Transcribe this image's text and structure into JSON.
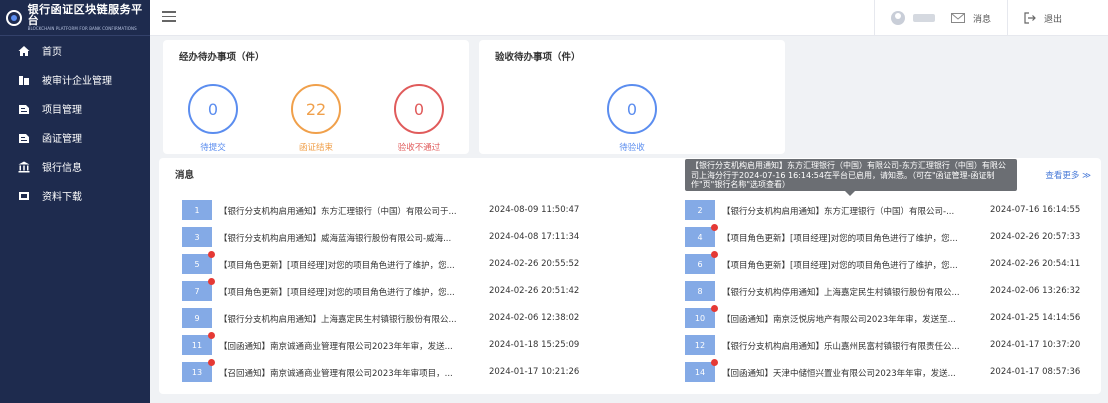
{
  "logo": {
    "title": "银行函证区块链服务平台",
    "subtitle": "BLOCKCHAIN PLATFORM FOR BANK CONFIRMATIONS"
  },
  "sidebar": {
    "items": [
      {
        "label": "首页",
        "icon": "home-icon"
      },
      {
        "label": "被审计企业管理",
        "icon": "building-icon"
      },
      {
        "label": "项目管理",
        "icon": "project-icon"
      },
      {
        "label": "函证管理",
        "icon": "letter-icon"
      },
      {
        "label": "银行信息",
        "icon": "bank-icon"
      },
      {
        "label": "资料下载",
        "icon": "download-icon"
      }
    ]
  },
  "header": {
    "messages_label": "消息",
    "logout_label": "退出"
  },
  "pending": {
    "title": "经办待办事项（件）",
    "stats": [
      {
        "value": "0",
        "label": "待提交",
        "color": "#5b8def"
      },
      {
        "value": "22",
        "label": "函证结束",
        "color": "#f0a04b"
      },
      {
        "value": "0",
        "label": "验收不通过",
        "color": "#e05b5b"
      }
    ]
  },
  "acceptance": {
    "title": "验收待办事项（件）",
    "stats": [
      {
        "value": "0",
        "label": "待验收",
        "color": "#5b8def"
      }
    ]
  },
  "messages": {
    "title": "消息",
    "view_more": "查看更多 ≫",
    "tooltip": "【银行分支机构启用通知】东方汇理银行（中国）有限公司-东方汇理银行（中国）有限公司上海分行于2024-07-16 16:14:54在平台已启用，请知悉。（可在\"函证管理-函证制作\"页\"银行名称\"选项查看）",
    "left": [
      {
        "num": "1",
        "text": "【银行分支机构启用通知】东方汇理银行（中国）有限公司于...",
        "date": "2024-08-09 11:50:47",
        "unread": false
      },
      {
        "num": "3",
        "text": "【银行分支机构启用通知】威海蓝海银行股份有限公司-威海...",
        "date": "2024-04-08 17:11:34",
        "unread": false
      },
      {
        "num": "5",
        "text": "【项目角色更新】[项目经理]对您的项目角色进行了维护，您...",
        "date": "2024-02-26 20:55:52",
        "unread": true
      },
      {
        "num": "7",
        "text": "【项目角色更新】[项目经理]对您的项目角色进行了维护，您...",
        "date": "2024-02-26 20:51:42",
        "unread": true
      },
      {
        "num": "9",
        "text": "【银行分支机构启用通知】上海嘉定民生村镇银行股份有限公...",
        "date": "2024-02-06 12:38:02",
        "unread": false
      },
      {
        "num": "11",
        "text": "【回函通知】南京诚通商业管理有限公司2023年年审，发送...",
        "date": "2024-01-18 15:25:09",
        "unread": true
      },
      {
        "num": "13",
        "text": "【召回通知】南京诚通商业管理有限公司2023年年审项目，...",
        "date": "2024-01-17 10:21:26",
        "unread": true
      }
    ],
    "right": [
      {
        "num": "2",
        "text": "【银行分支机构启用通知】东方汇理银行（中国）有限公司-...",
        "date": "2024-07-16 16:14:55",
        "unread": false
      },
      {
        "num": "4",
        "text": "【项目角色更新】[项目经理]对您的项目角色进行了维护，您...",
        "date": "2024-02-26 20:57:33",
        "unread": true
      },
      {
        "num": "6",
        "text": "【项目角色更新】[项目经理]对您的项目角色进行了维护，您...",
        "date": "2024-02-26 20:54:11",
        "unread": true
      },
      {
        "num": "8",
        "text": "【银行分支机构停用通知】上海嘉定民生村镇银行股份有限公...",
        "date": "2024-02-06 13:26:32",
        "unread": false
      },
      {
        "num": "10",
        "text": "【回函通知】南京泛悦房地产有限公司2023年年审，发送至...",
        "date": "2024-01-25 14:14:56",
        "unread": true
      },
      {
        "num": "12",
        "text": "【银行分支机构启用通知】乐山嘉州民富村镇银行有限责任公...",
        "date": "2024-01-17 10:37:20",
        "unread": false
      },
      {
        "num": "14",
        "text": "【回函通知】天津中储恒兴置业有限公司2023年年审，发送...",
        "date": "2024-01-17 08:57:36",
        "unread": true
      }
    ]
  }
}
